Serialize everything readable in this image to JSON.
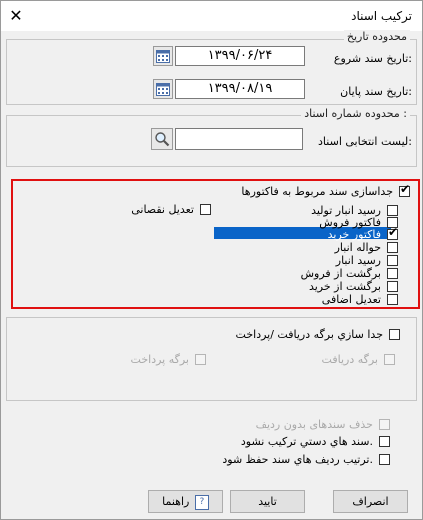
{
  "window": {
    "title": "ترکیب اسناد",
    "close_symbol": "✕"
  },
  "date_range": {
    "legend": "محدوده تاريخ",
    "start_label": "تاريخ سند شروع:",
    "start_value": "۱۳۹۹/۰۶/۲۴",
    "end_label": "تاريخ سند پايان:",
    "end_value": "۱۳۹۹/۰۸/۱۹"
  },
  "doc_number_range": {
    "legend": "محدوده شماره اسناد :",
    "list_label": "ليست انتخابی اسناد:",
    "list_value": ""
  },
  "invoices": {
    "separate_label": "جداسازی سند مربوط به فاکتورها",
    "separate_checked": true,
    "deficit_adjust_label": "تعديل نقصانی",
    "items": [
      {
        "label": "رسيد انبار توليد",
        "checked": false
      },
      {
        "label": "فاکتور فروش",
        "checked": false
      },
      {
        "label": "فاکتور خريد",
        "checked": true
      },
      {
        "label": "حواله انبار",
        "checked": false
      },
      {
        "label": "رسيد انبار",
        "checked": false
      },
      {
        "label": "برگشت از فروش",
        "checked": false
      },
      {
        "label": "برگشت از خريد",
        "checked": false
      },
      {
        "label": "تعديل اضافی",
        "checked": false
      }
    ]
  },
  "receipts": {
    "separate_label": "جدا سازي برگه دريافت /پرداخت",
    "receive_label": "برگه دريافت",
    "pay_label": "برگه پرداخت"
  },
  "options": [
    {
      "label": "حذف سندهای بدون رديف",
      "disabled": true
    },
    {
      "label": "سند هاي دستي ترکيب نشود.",
      "disabled": false
    },
    {
      "label": "ترتيب رديف هاي سند حفظ شود.",
      "disabled": false
    }
  ],
  "buttons": {
    "cancel": "انصراف",
    "confirm": "تاييد",
    "help": "راهنما"
  },
  "colors": {
    "highlight": "#0a64c8",
    "red_frame": "#e01010"
  }
}
